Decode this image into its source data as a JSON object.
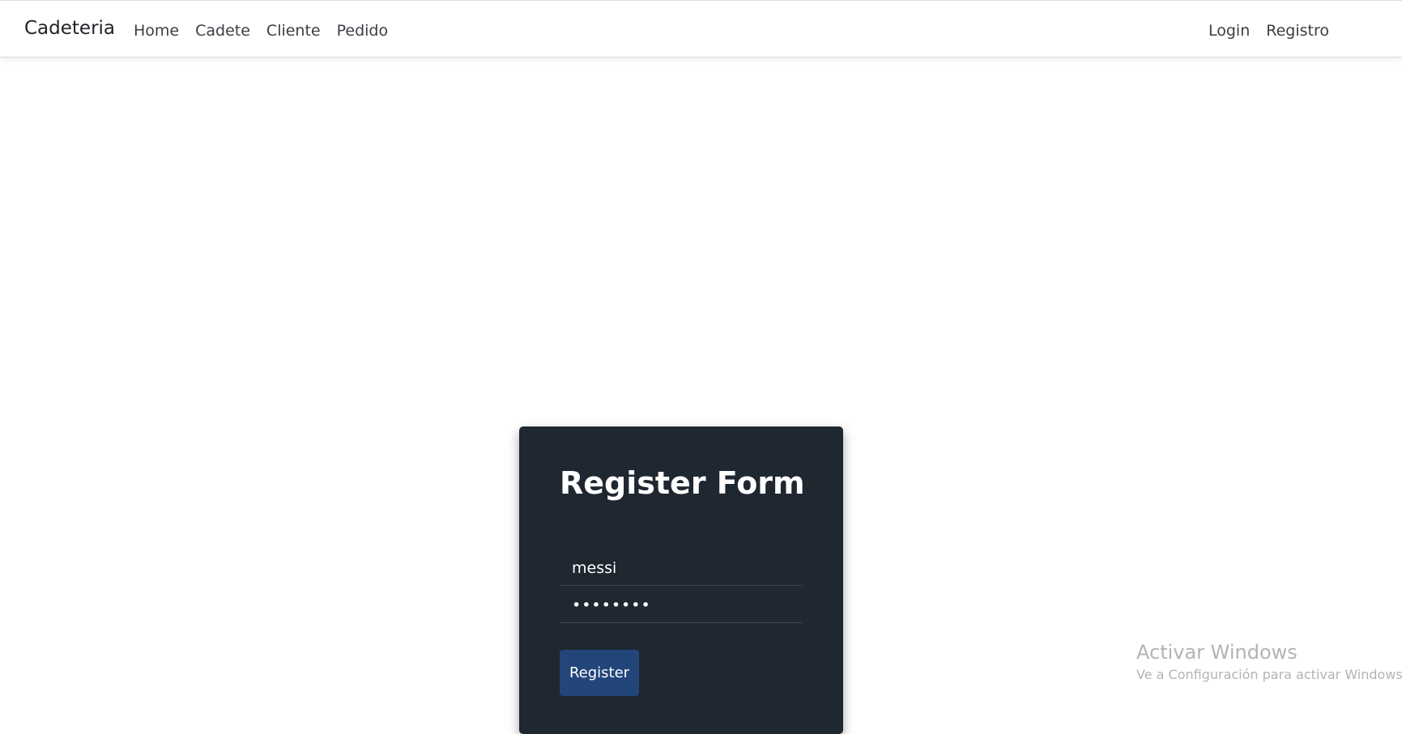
{
  "navbar": {
    "brand": "Cadeteria",
    "left_links": [
      "Home",
      "Cadete",
      "Cliente",
      "Pedido"
    ],
    "right_links": [
      "Login",
      "Registro"
    ]
  },
  "form": {
    "title": "Register Form",
    "username_value": "messi",
    "password_value": "••••••••",
    "submit_label": "Register"
  },
  "watermark": {
    "title": "Activar Windows",
    "subtitle": "Ve a Configuración para activar Windows."
  },
  "colors": {
    "card_background": "#1f2731",
    "button_background": "#22467a",
    "navbar_background": "#ffffff"
  }
}
